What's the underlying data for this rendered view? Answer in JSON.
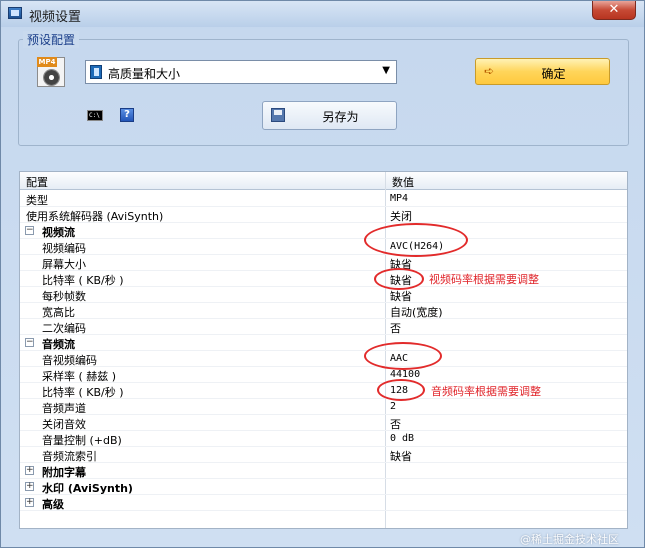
{
  "window": {
    "title": "视频设置",
    "close": "✕"
  },
  "presets": {
    "legend": "预设配置",
    "mp4_tag": "MP4",
    "selected_preset": "高质量和大小",
    "ok_label": "确定",
    "saveas_label": "另存为",
    "cmd_text": "C:\\"
  },
  "grid": {
    "header": {
      "key": "配置",
      "value": "数值"
    },
    "rows": {
      "type": {
        "k": "类型",
        "v": "MP4"
      },
      "decoder": {
        "k": "使用系统解码器 (AviSynth)",
        "v": "关闭"
      },
      "video_stream": {
        "k": "视频流"
      },
      "video_codec": {
        "k": "视频编码",
        "v": "AVC(H264)"
      },
      "screen_size": {
        "k": "屏幕大小",
        "v": "缺省"
      },
      "v_bitrate": {
        "k": "比特率 ( KB/秒 )",
        "v": "缺省"
      },
      "fps": {
        "k": "每秒帧数",
        "v": "缺省"
      },
      "aspect": {
        "k": "宽高比",
        "v": "自动(宽度)"
      },
      "two_pass": {
        "k": "二次编码",
        "v": "否"
      },
      "audio_stream": {
        "k": "音频流"
      },
      "audio_codec": {
        "k": "音视频编码",
        "v": "AAC"
      },
      "sample_rate": {
        "k": "采样率 ( 赫兹 )",
        "v": "44100"
      },
      "a_bitrate": {
        "k": "比特率 ( KB/秒 )",
        "v": "128"
      },
      "channels": {
        "k": "音频声道",
        "v": "2"
      },
      "mute": {
        "k": "关闭音效",
        "v": "否"
      },
      "volume": {
        "k": "音量控制 (+dB)",
        "v": "0 dB"
      },
      "audio_index": {
        "k": "音频流索引",
        "v": "缺省"
      },
      "subtitles": {
        "k": "附加字幕"
      },
      "watermark": {
        "k": "水印 (AviSynth)"
      },
      "advanced": {
        "k": "高级"
      }
    }
  },
  "annotations": {
    "video_note": "视频码率根据需要调整",
    "audio_note": "音频码率根据需要调整"
  },
  "watermark_text": "@稀土掘金技术社区",
  "colors": {
    "annotation": "#e22b2b",
    "ok_button": "#ffd55a"
  }
}
